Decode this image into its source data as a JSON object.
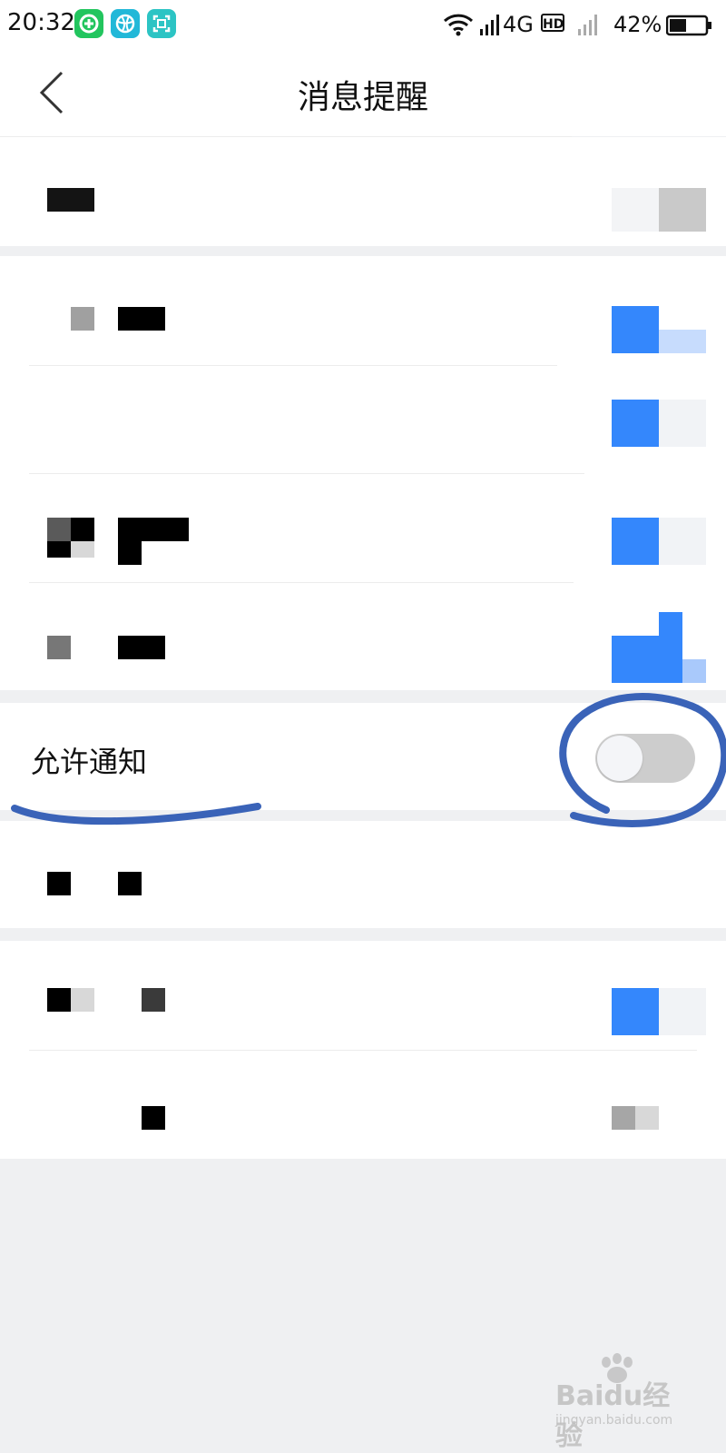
{
  "status_bar": {
    "time": "20:32",
    "network": "4G",
    "hd": "HD",
    "battery": "42%",
    "app_icons": [
      "green-app-icon",
      "basketball-app-icon",
      "scan-app-icon"
    ]
  },
  "header": {
    "title": "消息提醒",
    "back_icon": "chevron-left-icon"
  },
  "settings": {
    "allow_notifications": {
      "label": "允许通知",
      "enabled": false
    }
  },
  "colors": {
    "accent_blue": "#3487fc",
    "annotation_ink": "#3a63b8",
    "toggle_off": "#cdcdcd"
  },
  "watermark": {
    "brand": "Baidu经验",
    "url": "jingyan.baidu.com"
  }
}
